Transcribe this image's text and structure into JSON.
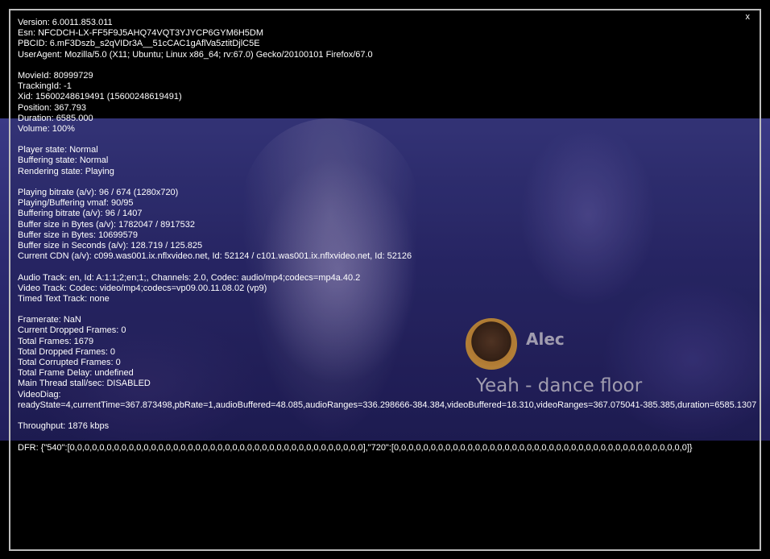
{
  "subtitle": {
    "speaker": "Alec",
    "text": "Yeah - dance floor"
  },
  "overlay": {
    "close_label": "x",
    "groups": [
      [
        "Version: 6.0011.853.011",
        "Esn: NFCDCH-LX-FF5F9J5AHQ74VQT3YJYCP6GYM6H5DM",
        "PBCID: 6.mF3Dszb_s2qVIDr3A__51cCAC1gAflVa5ztitDjlC5E",
        "UserAgent: Mozilla/5.0 (X11; Ubuntu; Linux x86_64; rv:67.0) Gecko/20100101 Firefox/67.0"
      ],
      [
        "MovieId: 80999729",
        "TrackingId: -1",
        "Xid: 15600248619491 (15600248619491)",
        "Position: 367.793",
        "Duration: 6585.000",
        "Volume: 100%"
      ],
      [
        "Player state: Normal",
        "Buffering state: Normal",
        "Rendering state: Playing"
      ],
      [
        "Playing bitrate (a/v): 96 / 674 (1280x720)",
        "Playing/Buffering vmaf: 90/95",
        "Buffering bitrate (a/v): 96 / 1407",
        "Buffer size in Bytes (a/v): 1782047 / 8917532",
        "Buffer size in Bytes: 10699579",
        "Buffer size in Seconds (a/v): 128.719 / 125.825",
        "Current CDN (a/v): c099.was001.ix.nflxvideo.net, Id: 52124 / c101.was001.ix.nflxvideo.net, Id: 52126"
      ],
      [
        "Audio Track: en, Id: A:1:1;2;en;1;, Channels: 2.0, Codec: audio/mp4;codecs=mp4a.40.2",
        "Video Track: Codec: video/mp4;codecs=vp09.00.11.08.02 (vp9)",
        "Timed Text Track: none"
      ],
      [
        "Framerate: NaN",
        "Current Dropped Frames: 0",
        "Total Frames: 1679",
        "Total Dropped Frames: 0",
        "Total Corrupted Frames: 0",
        "Total Frame Delay: undefined",
        "Main Thread stall/sec: DISABLED",
        "VideoDiag:",
        "readyState=4,currentTime=367.873498,pbRate=1,audioBuffered=48.085,audioRanges=336.298666-384.384,videoBuffered=18.310,videoRanges=367.075041-385.385,duration=6585.1307"
      ],
      [
        "Throughput: 1876 kbps"
      ],
      [
        "DFR: {\"540\":[0,0,0,0,0,0,0,0,0,0,0,0,0,0,0,0,0,0,0,0,0,0,0,0,0,0,0,0,0,0,0,0,0,0,0,0,0,0,0,0],\"720\":[0,0,0,0,0,0,0,0,0,0,0,0,0,0,0,0,0,0,0,0,0,0,0,0,0,0,0,0,0,0,0,0,0,0,0,0,0,0,0,0]}"
      ]
    ]
  }
}
